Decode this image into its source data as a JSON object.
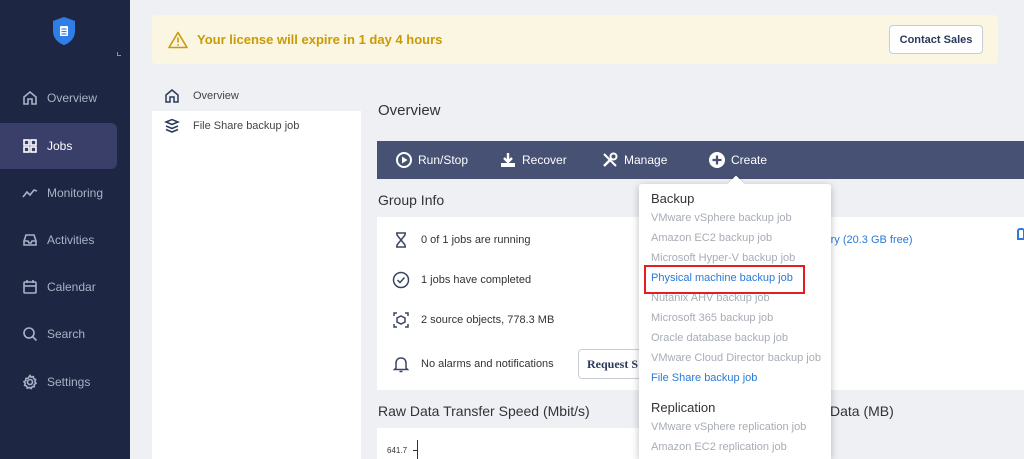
{
  "sidebar": {
    "items": [
      {
        "label": "Overview",
        "icon": "home-icon"
      },
      {
        "label": "Jobs",
        "icon": "jobs-grid-icon"
      },
      {
        "label": "Monitoring",
        "icon": "trend-line-icon"
      },
      {
        "label": "Activities",
        "icon": "inbox-tray-icon"
      },
      {
        "label": "Calendar",
        "icon": "calendar-icon"
      },
      {
        "label": "Search",
        "icon": "search-icon"
      },
      {
        "label": "Settings",
        "icon": "gear-icon"
      }
    ],
    "active": "Jobs"
  },
  "banner": {
    "message": "Your license will expire in 1 day 4 hours",
    "contact_label": "Contact Sales"
  },
  "tree": {
    "items": [
      {
        "label": "Overview",
        "icon": "home-icon"
      },
      {
        "label": "File Share backup job",
        "icon": "file-share-stack-icon"
      }
    ]
  },
  "main": {
    "title": "Overview",
    "toolbar": {
      "run_stop": "Run/Stop",
      "recover": "Recover",
      "manage": "Manage",
      "create": "Create"
    },
    "group_info": {
      "title": "Group Info",
      "rows": [
        "0 of 1 jobs are running",
        "1 jobs have completed",
        "2 source objects, 778.3 MB",
        "No alarms and notifications"
      ],
      "request_button": "Request S",
      "repository_link": "itory (20.3 GB free)"
    },
    "speed_title": "Raw Data Transfer Speed (Mbit/s)",
    "data_title": "Data (MB)",
    "chart_tick": "641.7"
  },
  "dropdown": {
    "backup_header": "Backup",
    "backup_items": [
      {
        "label": "VMware vSphere backup job",
        "enabled": false
      },
      {
        "label": "Amazon EC2 backup job",
        "enabled": false
      },
      {
        "label": "Microsoft Hyper-V backup job",
        "enabled": false
      },
      {
        "label": "Physical machine backup job",
        "enabled": true
      },
      {
        "label": "Nutanix AHV backup job",
        "enabled": false
      },
      {
        "label": "Microsoft 365 backup job",
        "enabled": false
      },
      {
        "label": "Oracle database backup job",
        "enabled": false
      },
      {
        "label": "VMware Cloud Director backup job",
        "enabled": false
      },
      {
        "label": "File Share backup job",
        "enabled": true
      }
    ],
    "replication_header": "Replication",
    "replication_items": [
      {
        "label": "VMware vSphere replication job",
        "enabled": false
      },
      {
        "label": "Amazon EC2 replication job",
        "enabled": false
      }
    ]
  },
  "colors": {
    "sidebar_bg": "#1d2744",
    "toolbar_bg": "#465173",
    "warning_text": "#c99a06",
    "link": "#2a7ad6",
    "highlight": "#e02020"
  }
}
